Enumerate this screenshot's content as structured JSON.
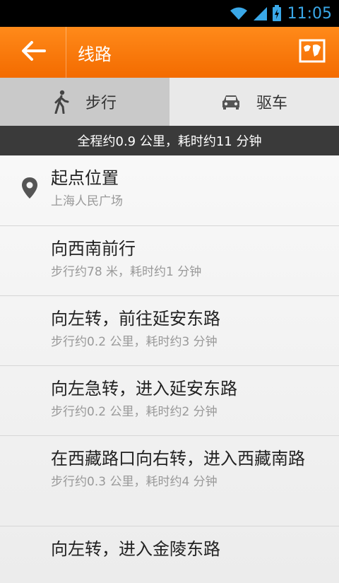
{
  "statusbar": {
    "time": "11:05"
  },
  "appbar": {
    "title": "线路"
  },
  "tabs": [
    {
      "label": "步行",
      "icon": "walk-icon",
      "active": true
    },
    {
      "label": "驱车",
      "icon": "car-icon",
      "active": false
    }
  ],
  "summary": "全程约0.9 公里，耗时约11 分钟",
  "steps": [
    {
      "main": "起点位置",
      "sub": "上海人民广场",
      "icon": "location-pin-icon"
    },
    {
      "main": "向西南前行",
      "sub": "步行约78 米，耗时约1 分钟"
    },
    {
      "main": "向左转，前往延安东路",
      "sub": "步行约0.2 公里，耗时约3 分钟"
    },
    {
      "main": "向左急转，进入延安东路",
      "sub": "步行约0.2 公里，耗时约2 分钟"
    },
    {
      "main": "在西藏路口向右转，进入西藏南路",
      "sub": "步行约0.3 公里，耗时约4 分钟"
    },
    {
      "main": "向左转，进入金陵东路",
      "sub": ""
    }
  ],
  "colors": {
    "accent": "#f47a10",
    "status_text": "#3aa8e8",
    "summary_bg": "#3a3a3a"
  }
}
